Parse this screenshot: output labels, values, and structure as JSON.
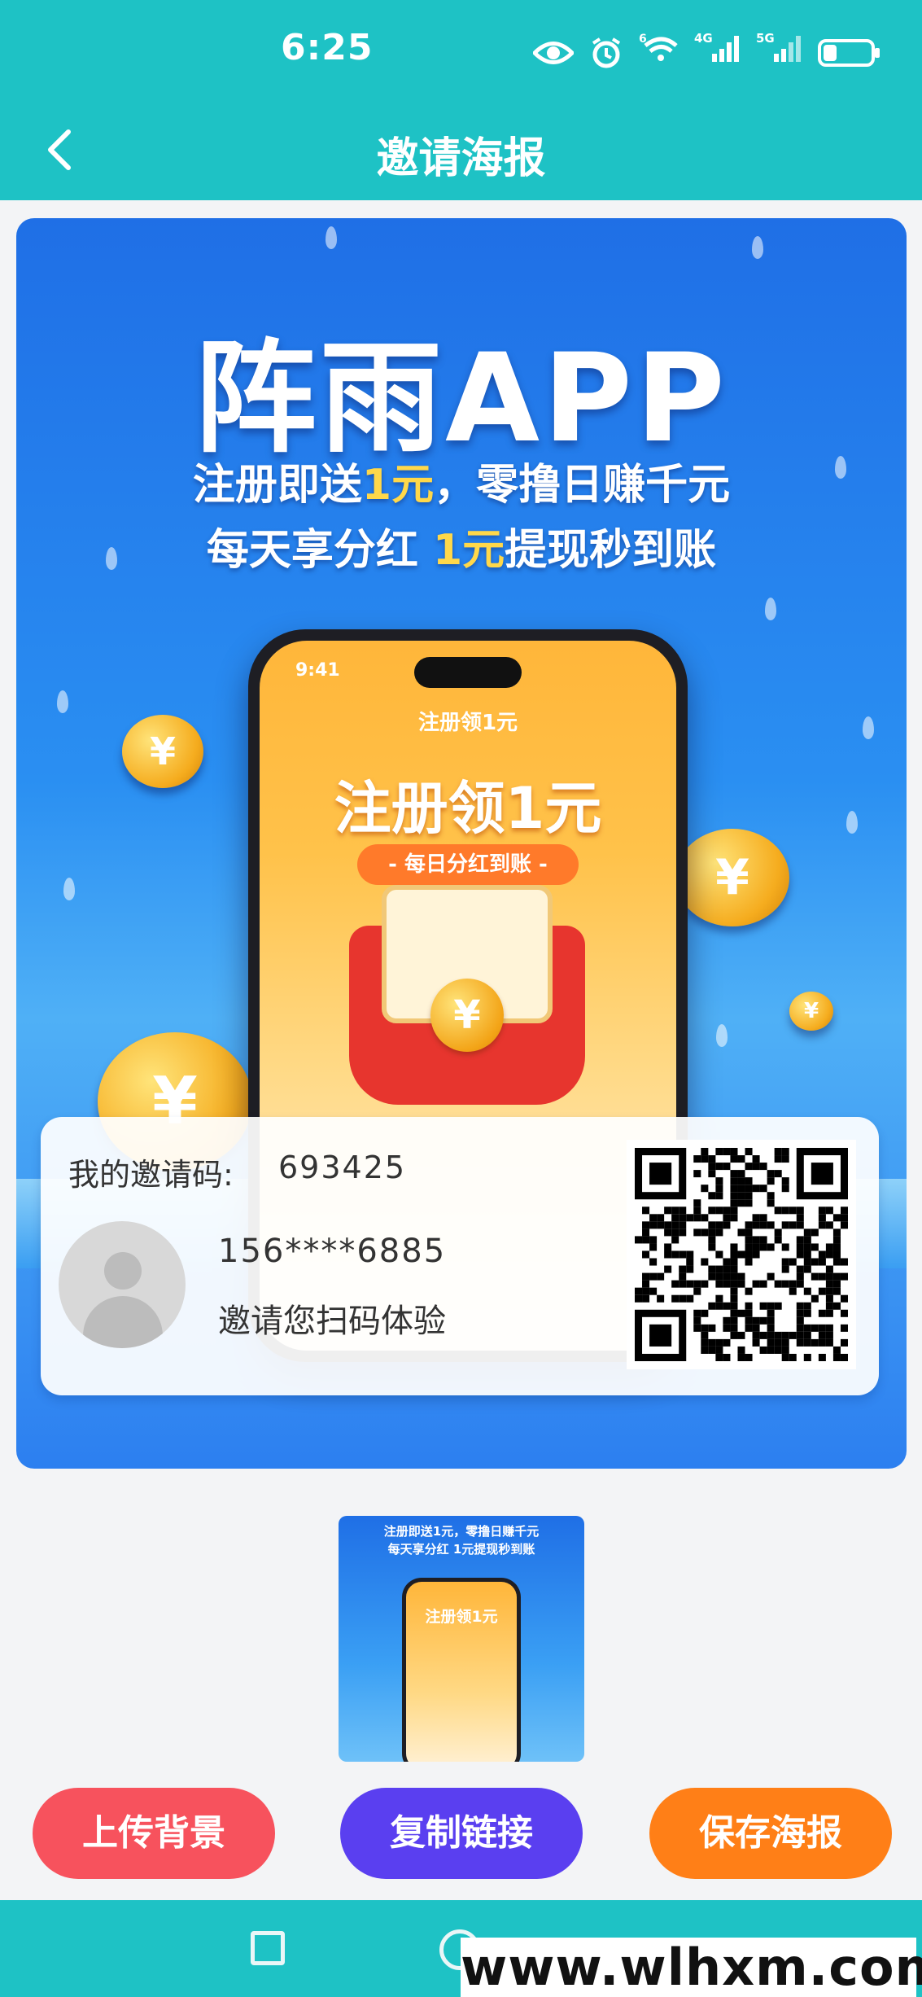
{
  "status_bar": {
    "time": "6:25",
    "icons": [
      "eye-icon",
      "alarm-icon",
      "wifi-icon",
      "signal-4g-icon",
      "signal-5g-icon",
      "battery-icon"
    ],
    "wifi_badge": "6",
    "net1": "4G",
    "net2": "5G"
  },
  "header": {
    "title": "邀请海报",
    "back_icon": "chevron-left-icon"
  },
  "poster": {
    "title": "阵雨APP",
    "sub_line1_a": "注册即送",
    "sub_line1_hl": "1元",
    "sub_line1_b": "，零撸日赚千元",
    "sub_line2_a": "每天享分红 ",
    "sub_line2_hl": "1元",
    "sub_line2_b": "提现秒到账",
    "phone": {
      "time": "9:41",
      "title": "注册领1元",
      "big": "注册领1元",
      "pill": "- 每日分红到账 -",
      "currency": "¥"
    }
  },
  "invite": {
    "label": "我的邀请码:",
    "code": "693425",
    "phone": "156****6885",
    "message": "邀请您扫码体验"
  },
  "thumbnail": {
    "line1": "注册即送1元，零撸日赚千元",
    "line2": "每天享分红 1元提现秒到账",
    "big": "注册领1元"
  },
  "buttons": {
    "upload": "上传背景",
    "copy": "复制链接",
    "save": "保存海报"
  },
  "watermark": "www.wlhxm.com",
  "colors": {
    "header": "#1ec2c5",
    "upload": "#f7525d",
    "copy": "#5a3ff0",
    "save": "#ff7f17"
  }
}
